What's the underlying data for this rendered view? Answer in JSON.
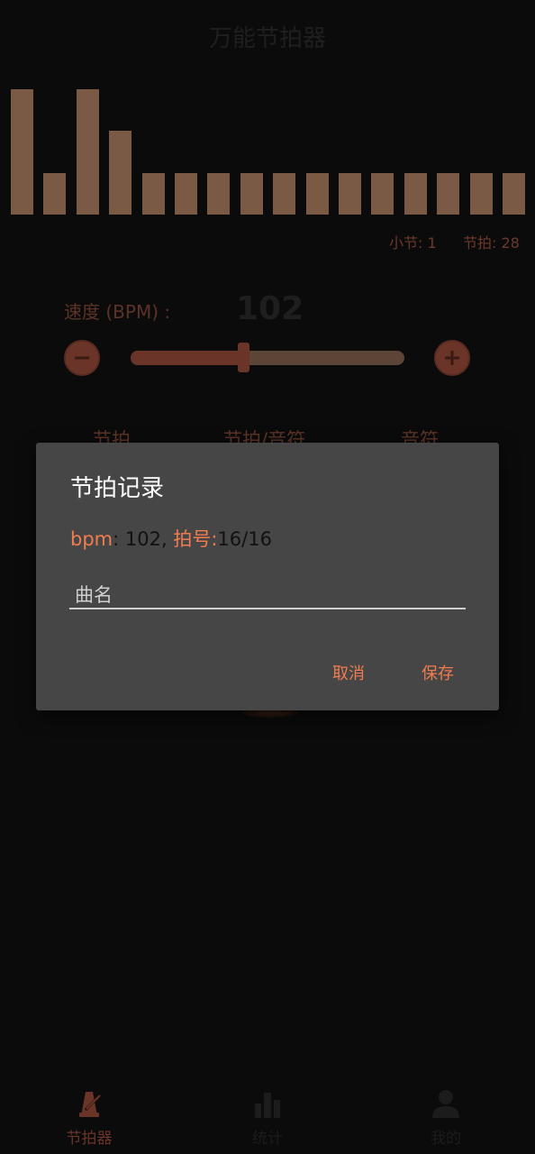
{
  "app": {
    "title": "万能节拍器"
  },
  "beats": {
    "levels": [
      3,
      1,
      3,
      2,
      1,
      1,
      1,
      1,
      1,
      1,
      1,
      1,
      1,
      1,
      1,
      1
    ],
    "bar_color": "#7a5a45"
  },
  "counters": {
    "measure_label": "小节:",
    "measure_value": "1",
    "beat_label": "节拍:",
    "beat_value": "28"
  },
  "speed": {
    "label": "速度 (BPM) :",
    "value": "102",
    "slider_fraction": 0.41,
    "minus_icon": "minus-circle-icon",
    "plus_icon": "plus-circle-icon"
  },
  "modes": {
    "tabs": [
      {
        "label": "节拍"
      },
      {
        "label": "节拍/音符"
      },
      {
        "label": "音符"
      }
    ]
  },
  "dialog": {
    "title": "节拍记录",
    "bpm_label": "bpm",
    "bpm_value": ": 102,",
    "sig_label": " 拍号:",
    "sig_value": "16/16",
    "name_placeholder": "曲名",
    "name_value": "",
    "cancel_label": "取消",
    "save_label": "保存"
  },
  "bottom_nav": {
    "items": [
      {
        "label": "节拍器",
        "icon": "metronome-icon",
        "active": true
      },
      {
        "label": "统计",
        "icon": "bar-chart-icon",
        "active": false
      },
      {
        "label": "我的",
        "icon": "person-icon",
        "active": false
      }
    ]
  },
  "colors": {
    "accent": "#f07c50",
    "background": "#0b0b0b",
    "dialog_background": "#464646"
  }
}
